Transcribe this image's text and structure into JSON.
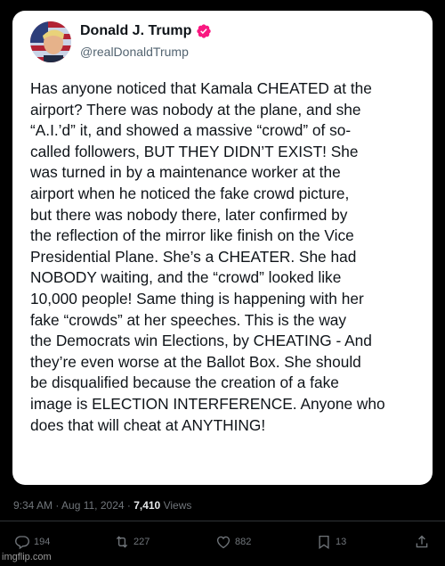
{
  "post": {
    "author_name": "Donald J. Trump",
    "author_handle": "@realDonaldTrump",
    "lines": [
      "Has anyone noticed that Kamala CHEATED at the",
      "airport? There was nobody at the plane, and she",
      "“A.I.’d” it, and showed a massive “crowd” of so-",
      "called followers, BUT THEY DIDN’T EXIST! She",
      "was turned in by a maintenance worker at the",
      "airport when he noticed the fake crowd picture,",
      "but there was nobody there, later confirmed by",
      "the reflection of the mirror like finish on the Vice",
      "Presidential Plane. She’s a CHEATER. She had",
      "NOBODY waiting, and the “crowd” looked like",
      "10,000 people! Same thing is happening with her",
      "fake “crowds” at her speeches. This is the way",
      "the Democrats win Elections, by CHEATING - And",
      "they’re even worse at the Ballot Box. She should",
      "be disqualified because the creation of a fake",
      "image is ELECTION INTERFERENCE. Anyone who",
      "does that will cheat at ANYTHING!"
    ]
  },
  "meta": {
    "time_date": "9:34 AM · Aug 11, 2024 · ",
    "views_count": "7,410",
    "views_label": " Views"
  },
  "actions": {
    "replies": "194",
    "reposts": "227",
    "likes": "882",
    "bookmarks": "13"
  },
  "icons": {
    "verified": "verified-badge-icon",
    "reply": "reply-icon",
    "repost": "repost-icon",
    "like": "heart-icon",
    "bookmark": "bookmark-icon",
    "share": "share-icon"
  },
  "colors": {
    "background": "#000000",
    "card": "#ffffff",
    "verified": "#f91880",
    "muted": "#71767b"
  },
  "watermark": "imgflip.com"
}
